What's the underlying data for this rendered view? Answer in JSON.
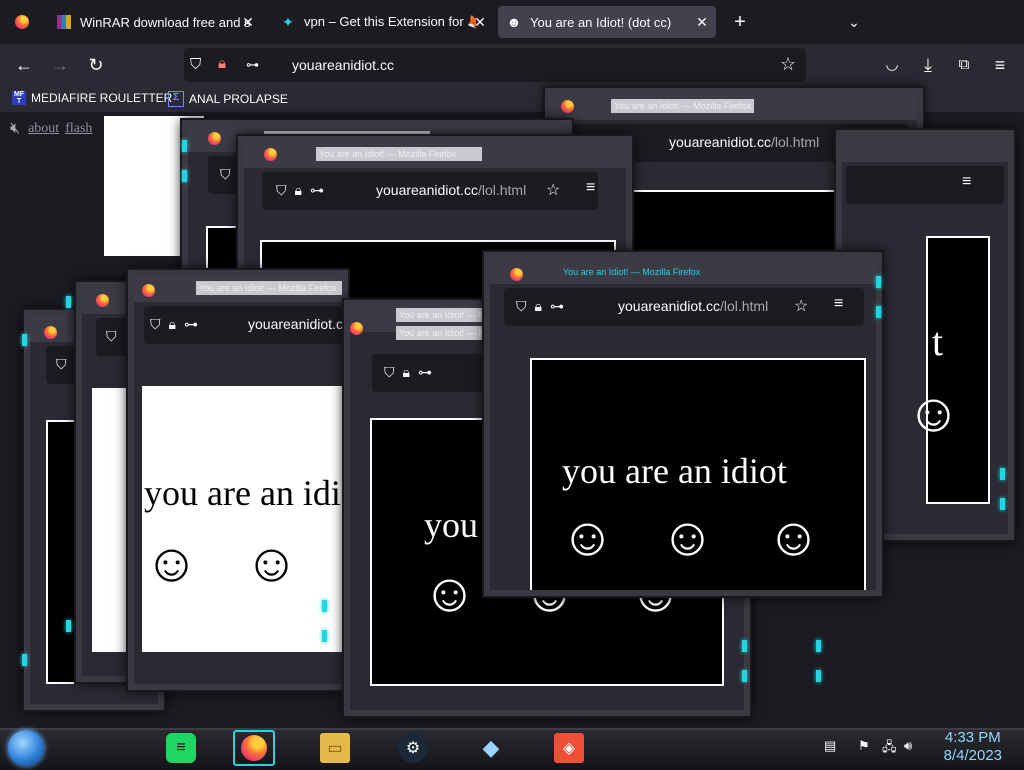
{
  "tabs": [
    {
      "title": "WinRAR download free and support",
      "icon": "winrar-icon"
    },
    {
      "title": "vpn – Get this Extension for 🦊 Firefox",
      "icon": "extension-icon"
    },
    {
      "title": "You are an Idiot! (dot cc)",
      "icon": "smiley-icon",
      "active": true
    }
  ],
  "url": "youareanidiot.cc",
  "bookmarks": [
    {
      "label": "MEDIAFIRE ROULETTER",
      "icon_text": "MF T"
    },
    {
      "label": "ANAL PROLAPSE"
    }
  ],
  "page_links": [
    "about",
    "flash"
  ],
  "popup": {
    "window_title": "You are an Idiot! — Mozilla Firefox",
    "url_host": "youareanidiot.cc",
    "url_path": "/lol.html",
    "message": "you are an idiot",
    "smiley": "☺"
  },
  "clock": {
    "time": "4:33 PM",
    "date": "8/4/2023"
  },
  "colors": {
    "accent_cyan": "#21d6e0",
    "chrome_dark": "#1c1b22",
    "chrome_mid": "#2b2a33"
  }
}
